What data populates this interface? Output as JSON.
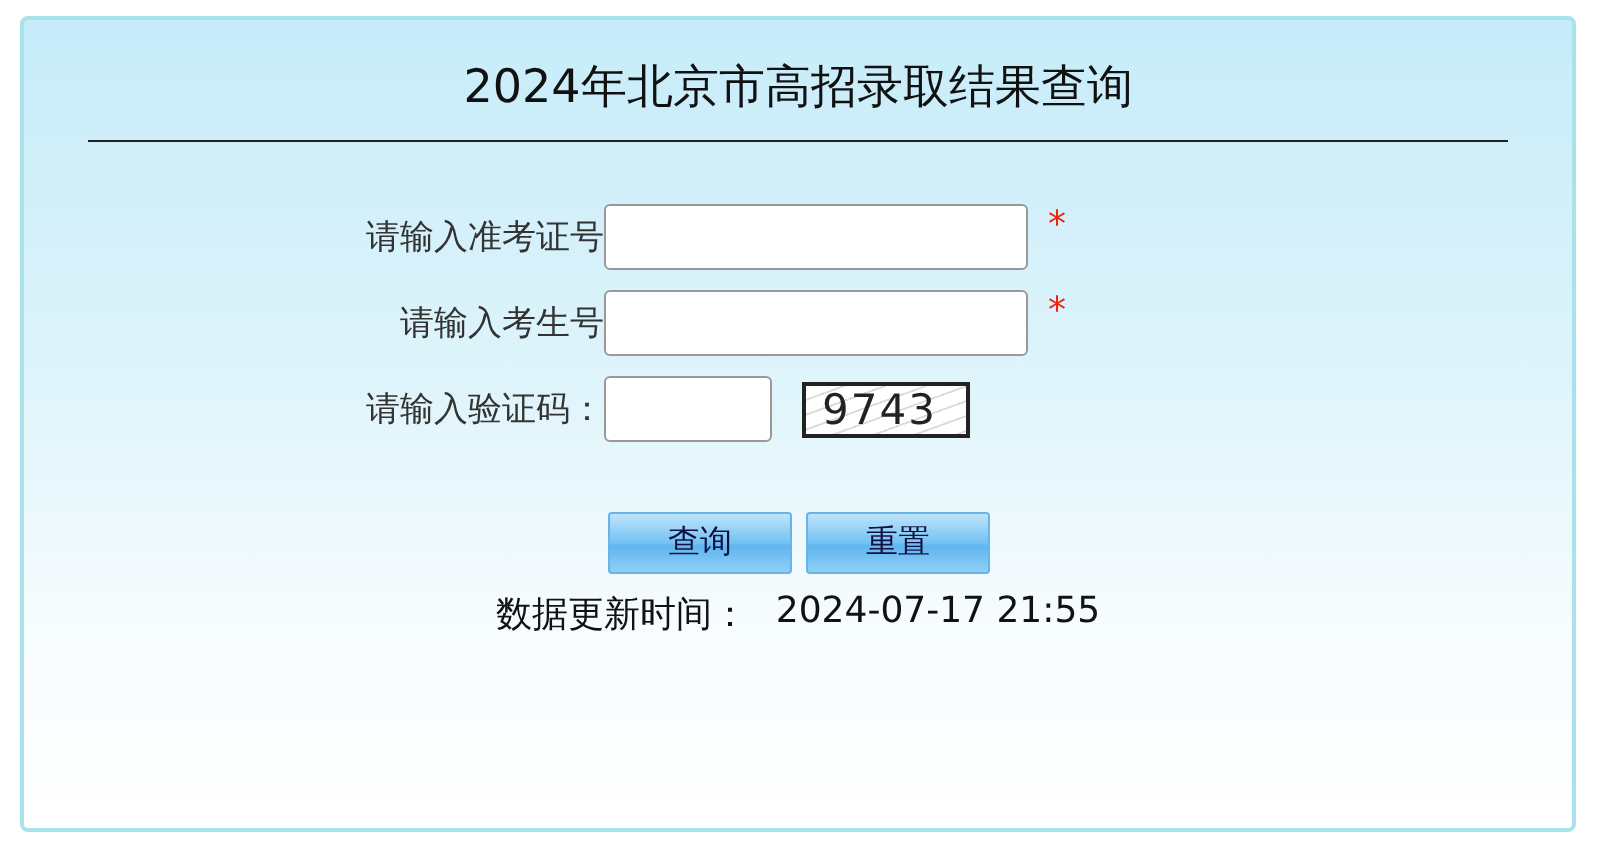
{
  "title": "2024年北京市高招录取结果查询",
  "fields": [
    {
      "kind": "text",
      "label": "请输入准考证号",
      "mark": "*"
    },
    {
      "kind": "text",
      "label": "请输入考生号",
      "mark": "*"
    },
    {
      "kind": "captcha",
      "label": "请输入验证码：",
      "captcha": "9743"
    }
  ],
  "buttons": [
    "查询",
    "重置"
  ],
  "update": {
    "label": "数据更新时间：",
    "value": "2024-07-17 21:55"
  }
}
